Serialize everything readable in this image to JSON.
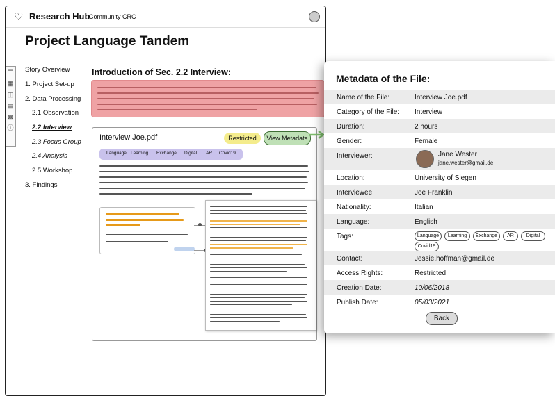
{
  "app": {
    "brand": "Research Hub",
    "community": "Community CRC",
    "logo_icon": "heart-logo-icon",
    "user_icon": "user-icon"
  },
  "page_title": "Project Language Tandem",
  "nav": {
    "items": [
      {
        "label": "Story Overview"
      },
      {
        "label": "1. Project Set-up"
      },
      {
        "label": "2. Data Processing"
      },
      {
        "label": "2.1 Observation"
      },
      {
        "label": "2.2 Interview"
      },
      {
        "label": "2.3 Focus Group"
      },
      {
        "label": "2.4 Analysis"
      },
      {
        "label": "2.5 Workshop"
      },
      {
        "label": "3. Findings"
      }
    ],
    "rail_icons": [
      "menu-icon",
      "calendar-icon",
      "book-icon",
      "document-icon",
      "image-icon",
      "info-icon"
    ]
  },
  "section_title": "Introduction of Sec. 2.2 Interview:",
  "file_card": {
    "title": "Interview Joe.pdf",
    "restricted": "Restricted",
    "view_metadata": "View Metadata",
    "tags": [
      "Language",
      "Learning",
      "Exchange",
      "Digital",
      "AR",
      "Covid19"
    ]
  },
  "metadata": {
    "title": "Metadata of the File:",
    "rows": [
      {
        "key": "Name of the File:",
        "value": "Interview Joe.pdf"
      },
      {
        "key": "Category of the File:",
        "value": "Interview"
      },
      {
        "key": "Duration:",
        "value": "2 hours"
      },
      {
        "key": "Gender:",
        "value": "Female"
      },
      {
        "key": "Interviewer:",
        "name": "Jane Wester",
        "email": "jane.wester@gmail.de"
      },
      {
        "key": "Location:",
        "value": "University of Siegen"
      },
      {
        "key": "Interviewee:",
        "value": "Joe Franklin"
      },
      {
        "key": "Nationality:",
        "value": "Italian"
      },
      {
        "key": "Language:",
        "value": "English"
      },
      {
        "key": "Tags:",
        "tags": [
          "Language",
          "Learning",
          "Exchange",
          "AR",
          "Digital",
          "Covid19"
        ]
      },
      {
        "key": "Contact:",
        "value": "Jessie.hoffman@gmail.de"
      },
      {
        "key": "Access Rights:",
        "value": "Restricted"
      },
      {
        "key": "Creation Date:",
        "value": "10/06/2018"
      },
      {
        "key": "Publish Date:",
        "value": "05/03/2021"
      }
    ],
    "back": "Back"
  },
  "colors": {
    "intro_box": "#efa2a4",
    "restricted": "#f4ec8c",
    "view_metadata": "#bfe0b6",
    "tag_bar": "#c9c2ec",
    "highlight": "#f0b34a",
    "row_gray": "#ebebeb"
  }
}
